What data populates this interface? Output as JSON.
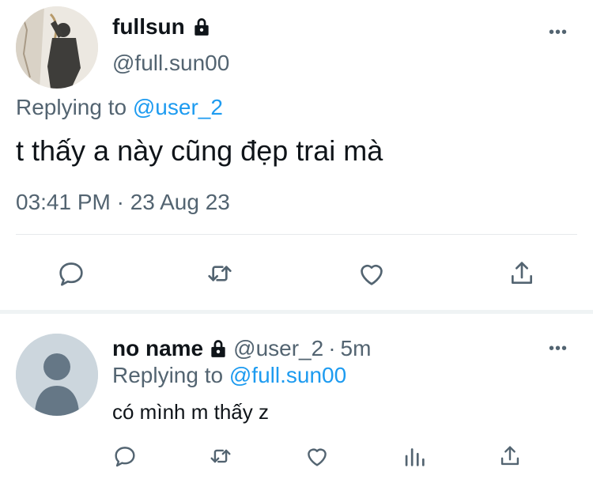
{
  "main_tweet": {
    "display_name": "fullsun",
    "handle": "@full.sun00",
    "replying_prefix": "Replying to",
    "replying_to": "@user_2",
    "text": "t thấy a này cũng đẹp trai mà",
    "timestamp": "03:41 PM · 23 Aug 23",
    "more_label": "•••",
    "actions": [
      "reply-icon",
      "retweet-icon",
      "like-icon",
      "share-icon"
    ]
  },
  "reply_tweet": {
    "display_name": "no name",
    "handle": "@user_2",
    "separator": "·",
    "time": "5m",
    "replying_prefix": "Replying to",
    "replying_to": "@full.sun00",
    "text": "có mình m thấy z",
    "more_label": "•••",
    "actions": [
      "reply-icon",
      "retweet-icon",
      "like-icon",
      "analytics-icon",
      "share-icon"
    ]
  },
  "colors": {
    "text": "#0f1419",
    "muted": "#536471",
    "link": "#1d9bf0",
    "divider": "#e6e9ec",
    "avatar_default": "#ccd6dd"
  }
}
